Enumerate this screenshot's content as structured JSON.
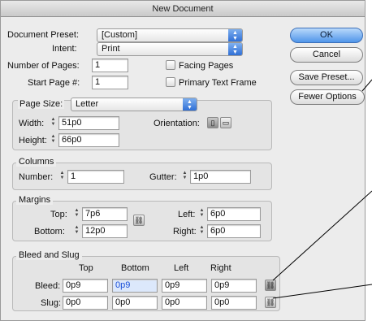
{
  "window": {
    "title": "New Document"
  },
  "document": {
    "preset_label": "Document Preset:",
    "preset_value": "[Custom]",
    "intent_label": "Intent:",
    "intent_value": "Print",
    "pages_label": "Number of Pages:",
    "pages_value": "1",
    "start_label": "Start Page #:",
    "start_value": "1",
    "facing_label": "Facing Pages",
    "primary_label": "Primary Text Frame"
  },
  "page_size": {
    "label": "Page Size:",
    "value": "Letter",
    "width_label": "Width:",
    "width_value": "51p0",
    "height_label": "Height:",
    "height_value": "66p0",
    "orientation_label": "Orientation:"
  },
  "columns": {
    "title": "Columns",
    "number_label": "Number:",
    "number_value": "1",
    "gutter_label": "Gutter:",
    "gutter_value": "1p0"
  },
  "margins": {
    "title": "Margins",
    "top_label": "Top:",
    "top_value": "7p6",
    "bottom_label": "Bottom:",
    "bottom_value": "12p0",
    "left_label": "Left:",
    "left_value": "6p0",
    "right_label": "Right:",
    "right_value": "6p0"
  },
  "bleed_slug": {
    "title": "Bleed and Slug",
    "headers": [
      "Top",
      "Bottom",
      "Left",
      "Right"
    ],
    "bleed_label": "Bleed:",
    "bleed_values": [
      "0p9",
      "0p9",
      "0p9",
      "0p9"
    ],
    "slug_label": "Slug:",
    "slug_values": [
      "0p0",
      "0p0",
      "0p0",
      "0p0"
    ]
  },
  "buttons": {
    "ok": "OK",
    "cancel": "Cancel",
    "save_preset": "Save Preset...",
    "fewer_options": "Fewer Options"
  },
  "colors": {
    "accent": "#4f95ea",
    "selected_text": "#1a4fd8"
  }
}
